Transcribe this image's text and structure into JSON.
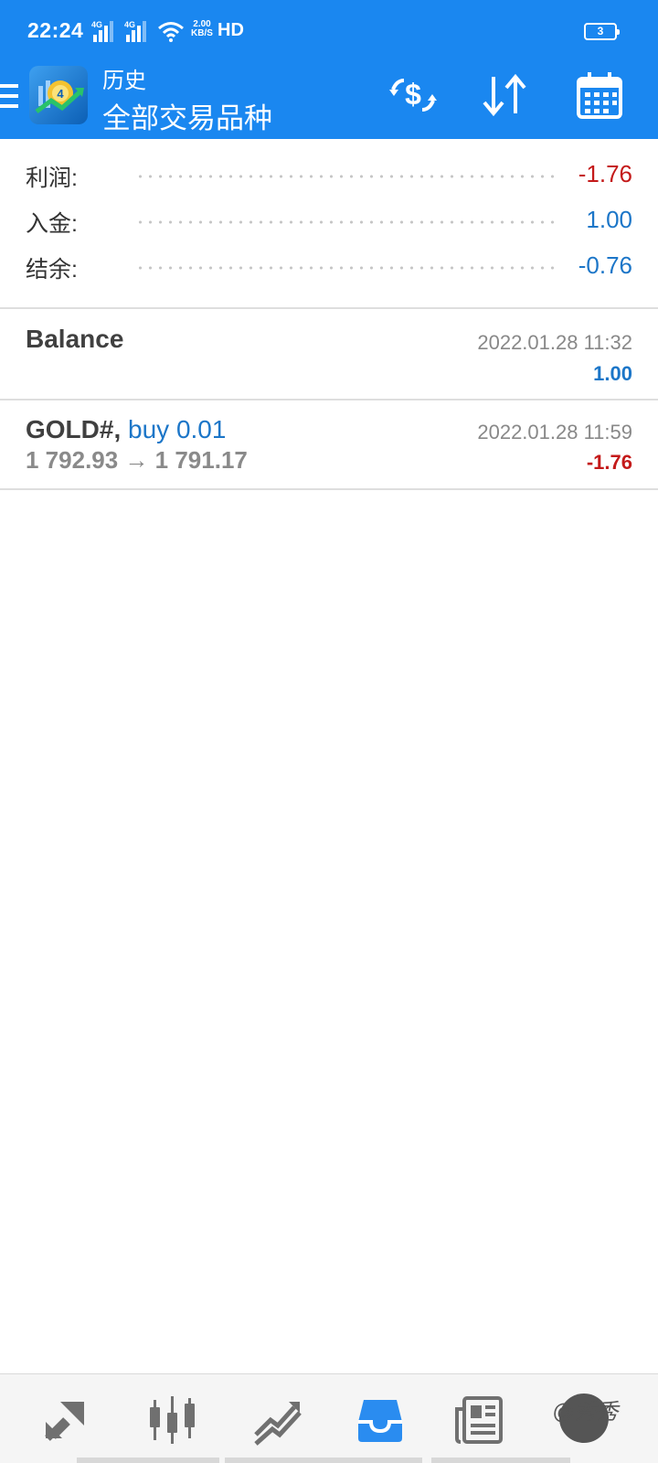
{
  "status_bar": {
    "time": "22:24",
    "signal1": "4G",
    "signal2": "4G",
    "net_speed_value": "2.00",
    "net_speed_unit": "KB/S",
    "hd": "HD",
    "battery": "3"
  },
  "header": {
    "subtitle": "历史",
    "title": "全部交易品种"
  },
  "summary": [
    {
      "label": "利润:",
      "value": "-1.76",
      "tone": "negative"
    },
    {
      "label": "入金:",
      "value": "1.00",
      "tone": "positive"
    },
    {
      "label": "结余:",
      "value": "-0.76",
      "tone": "positive"
    }
  ],
  "deals": [
    {
      "title": "Balance",
      "time": "2022.01.28 11:32",
      "amount": "1.00",
      "tone": "positive"
    },
    {
      "symbol": "GOLD#,",
      "action": "buy 0.01",
      "time": "2022.01.28 11:59",
      "prices": "1 792.93 → 1 791.17",
      "amount": "-1.76",
      "tone": "negative"
    }
  ],
  "bottom_nav": [
    "quotes-icon",
    "chart-icon",
    "trade-icon",
    "history-icon",
    "news-icon",
    "messages-icon"
  ],
  "watermark": "@秀秀",
  "colors": {
    "accent": "#1a87f0",
    "negative": "#c41a1a",
    "positive": "#1c76c8"
  }
}
